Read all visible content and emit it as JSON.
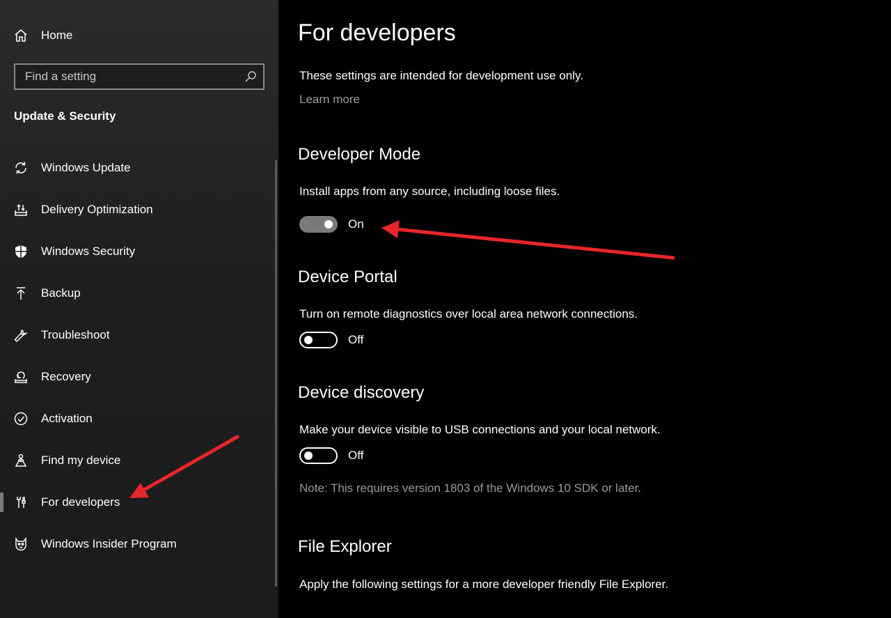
{
  "sidebar": {
    "home_label": "Home",
    "search_placeholder": "Find a setting",
    "section_title": "Update & Security",
    "items": [
      {
        "label": "Windows Update",
        "icon": "sync-icon"
      },
      {
        "label": "Delivery Optimization",
        "icon": "delivery-optimization-icon"
      },
      {
        "label": "Windows Security",
        "icon": "shield-icon"
      },
      {
        "label": "Backup",
        "icon": "backup-arrow-icon"
      },
      {
        "label": "Troubleshoot",
        "icon": "wrench-icon"
      },
      {
        "label": "Recovery",
        "icon": "recovery-icon"
      },
      {
        "label": "Activation",
        "icon": "check-circle-icon"
      },
      {
        "label": "Find my device",
        "icon": "person-location-icon"
      },
      {
        "label": "For developers",
        "icon": "developer-tools-icon",
        "selected": true
      },
      {
        "label": "Windows Insider Program",
        "icon": "insider-cat-icon"
      }
    ]
  },
  "main": {
    "title": "For developers",
    "intro": "These settings are intended for development use only.",
    "learn_more": "Learn more",
    "developer_mode": {
      "heading": "Developer Mode",
      "description": "Install apps from any source, including loose files.",
      "state": "On"
    },
    "device_portal": {
      "heading": "Device Portal",
      "description": "Turn on remote diagnostics over local area network connections.",
      "state": "Off"
    },
    "device_discovery": {
      "heading": "Device discovery",
      "description": "Make your device visible to USB connections and your local network.",
      "state": "Off",
      "note": "Note: This requires version 1803 of the Windows 10 SDK or later."
    },
    "file_explorer": {
      "heading": "File Explorer",
      "description": "Apply the following settings for a more developer friendly File Explorer."
    }
  },
  "colors": {
    "annotation_arrow": "#e8252b",
    "toggle_on": "#7a7a7a",
    "muted_text": "#9a9a9a"
  }
}
